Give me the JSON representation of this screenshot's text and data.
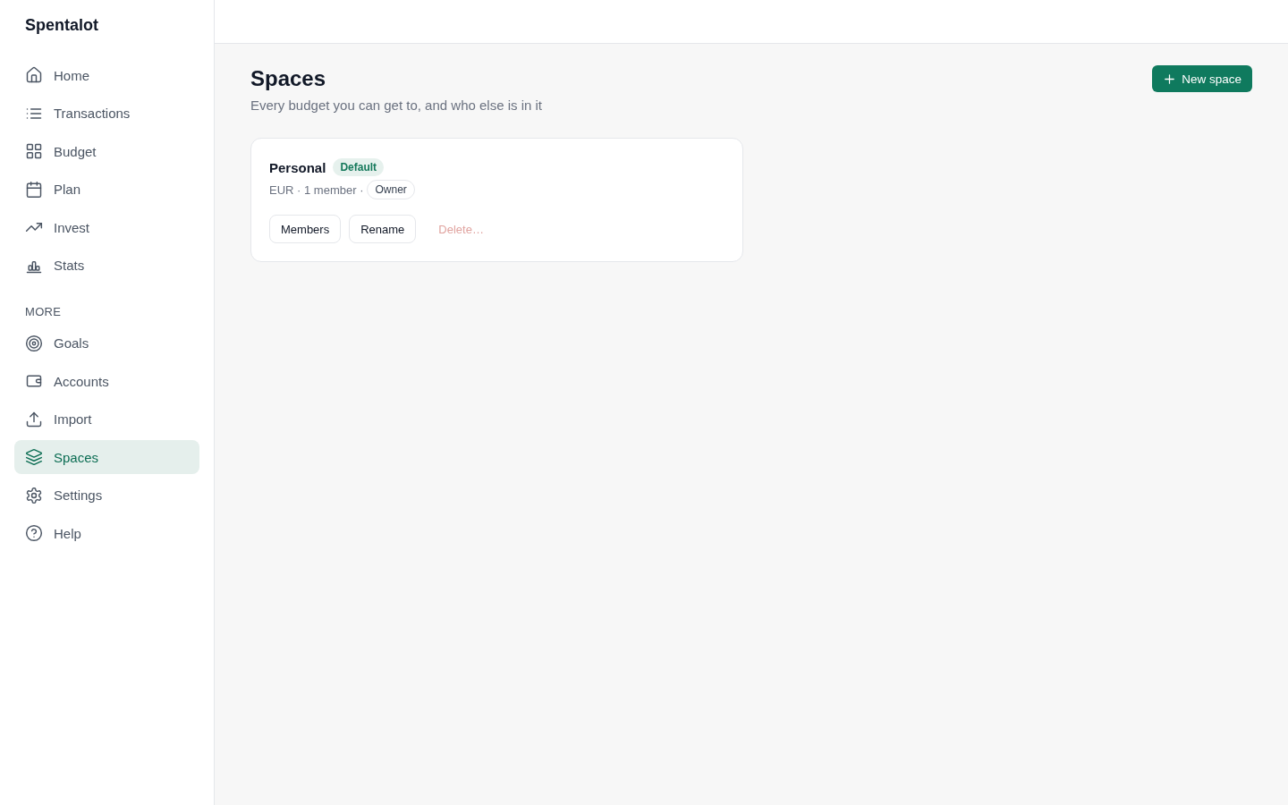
{
  "sidebar": {
    "brand": "Spentalot",
    "groups": [
      {
        "items": [
          {
            "label": "Home",
            "selected": false
          },
          {
            "label": "Transactions",
            "selected": false
          },
          {
            "label": "Budget",
            "selected": false
          },
          {
            "label": "Plan",
            "selected": false
          },
          {
            "label": "Invest",
            "selected": false
          },
          {
            "label": "Stats",
            "selected": false
          }
        ]
      },
      {
        "heading": "MORE",
        "items": [
          {
            "label": "Goals",
            "selected": false
          },
          {
            "label": "Accounts",
            "selected": false
          },
          {
            "label": "Import",
            "selected": false
          },
          {
            "label": "Spaces",
            "selected": true
          },
          {
            "label": "Settings",
            "selected": false
          },
          {
            "label": "Help",
            "selected": false
          }
        ]
      }
    ]
  },
  "page": {
    "title": "Spaces",
    "subtitle": "Every budget you can get to, and who else is in it",
    "new_button": "New space"
  },
  "spaces": [
    {
      "name": "Personal",
      "badge": "Default",
      "meta": "EUR · 1 member ·",
      "role": "Owner",
      "actions": [
        {
          "label": "Members",
          "kind": "outline",
          "disabled": false
        },
        {
          "label": "Rename",
          "kind": "outline",
          "disabled": false
        },
        {
          "label": "Delete…",
          "kind": "danger",
          "disabled": true
        }
      ]
    }
  ]
}
